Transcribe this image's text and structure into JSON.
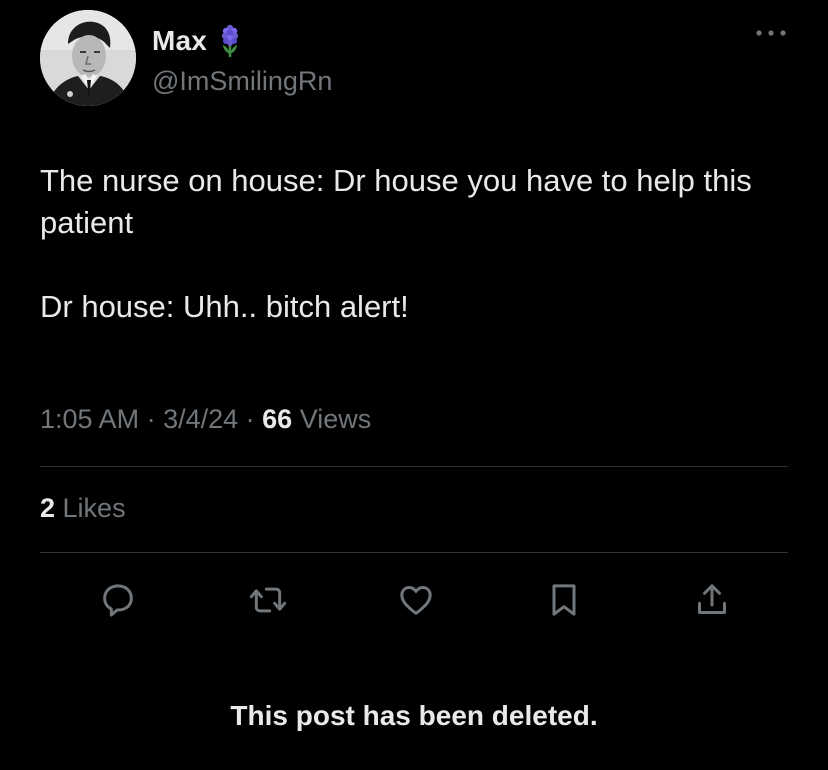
{
  "author": {
    "display_name": "Max",
    "handle": "@ImSmilingRn",
    "avatar_icon": "profile-photo",
    "badge_icon": "hyacinth-emoji"
  },
  "tweet": {
    "paragraphs": [
      "The nurse on house: Dr house you have to help this patient",
      "Dr house: Uhh.. bitch alert!"
    ]
  },
  "meta": {
    "time": "1:05 AM",
    "separator": " · ",
    "date": "3/4/24",
    "views_count": "66",
    "views_label": " Views"
  },
  "likes": {
    "count": "2",
    "label": " Likes"
  },
  "actions": [
    {
      "name": "reply",
      "icon": "speech-bubble-icon"
    },
    {
      "name": "repost",
      "icon": "repost-arrows-icon"
    },
    {
      "name": "like",
      "icon": "heart-icon"
    },
    {
      "name": "bookmark",
      "icon": "bookmark-icon"
    },
    {
      "name": "share",
      "icon": "share-upload-icon"
    }
  ],
  "footer": {
    "deleted_notice": "This post has been deleted."
  },
  "colors": {
    "background": "#000000",
    "primary_text": "#e7e9ea",
    "secondary_text": "#71767b",
    "divider": "#2f3336",
    "icon": "#71767b"
  }
}
